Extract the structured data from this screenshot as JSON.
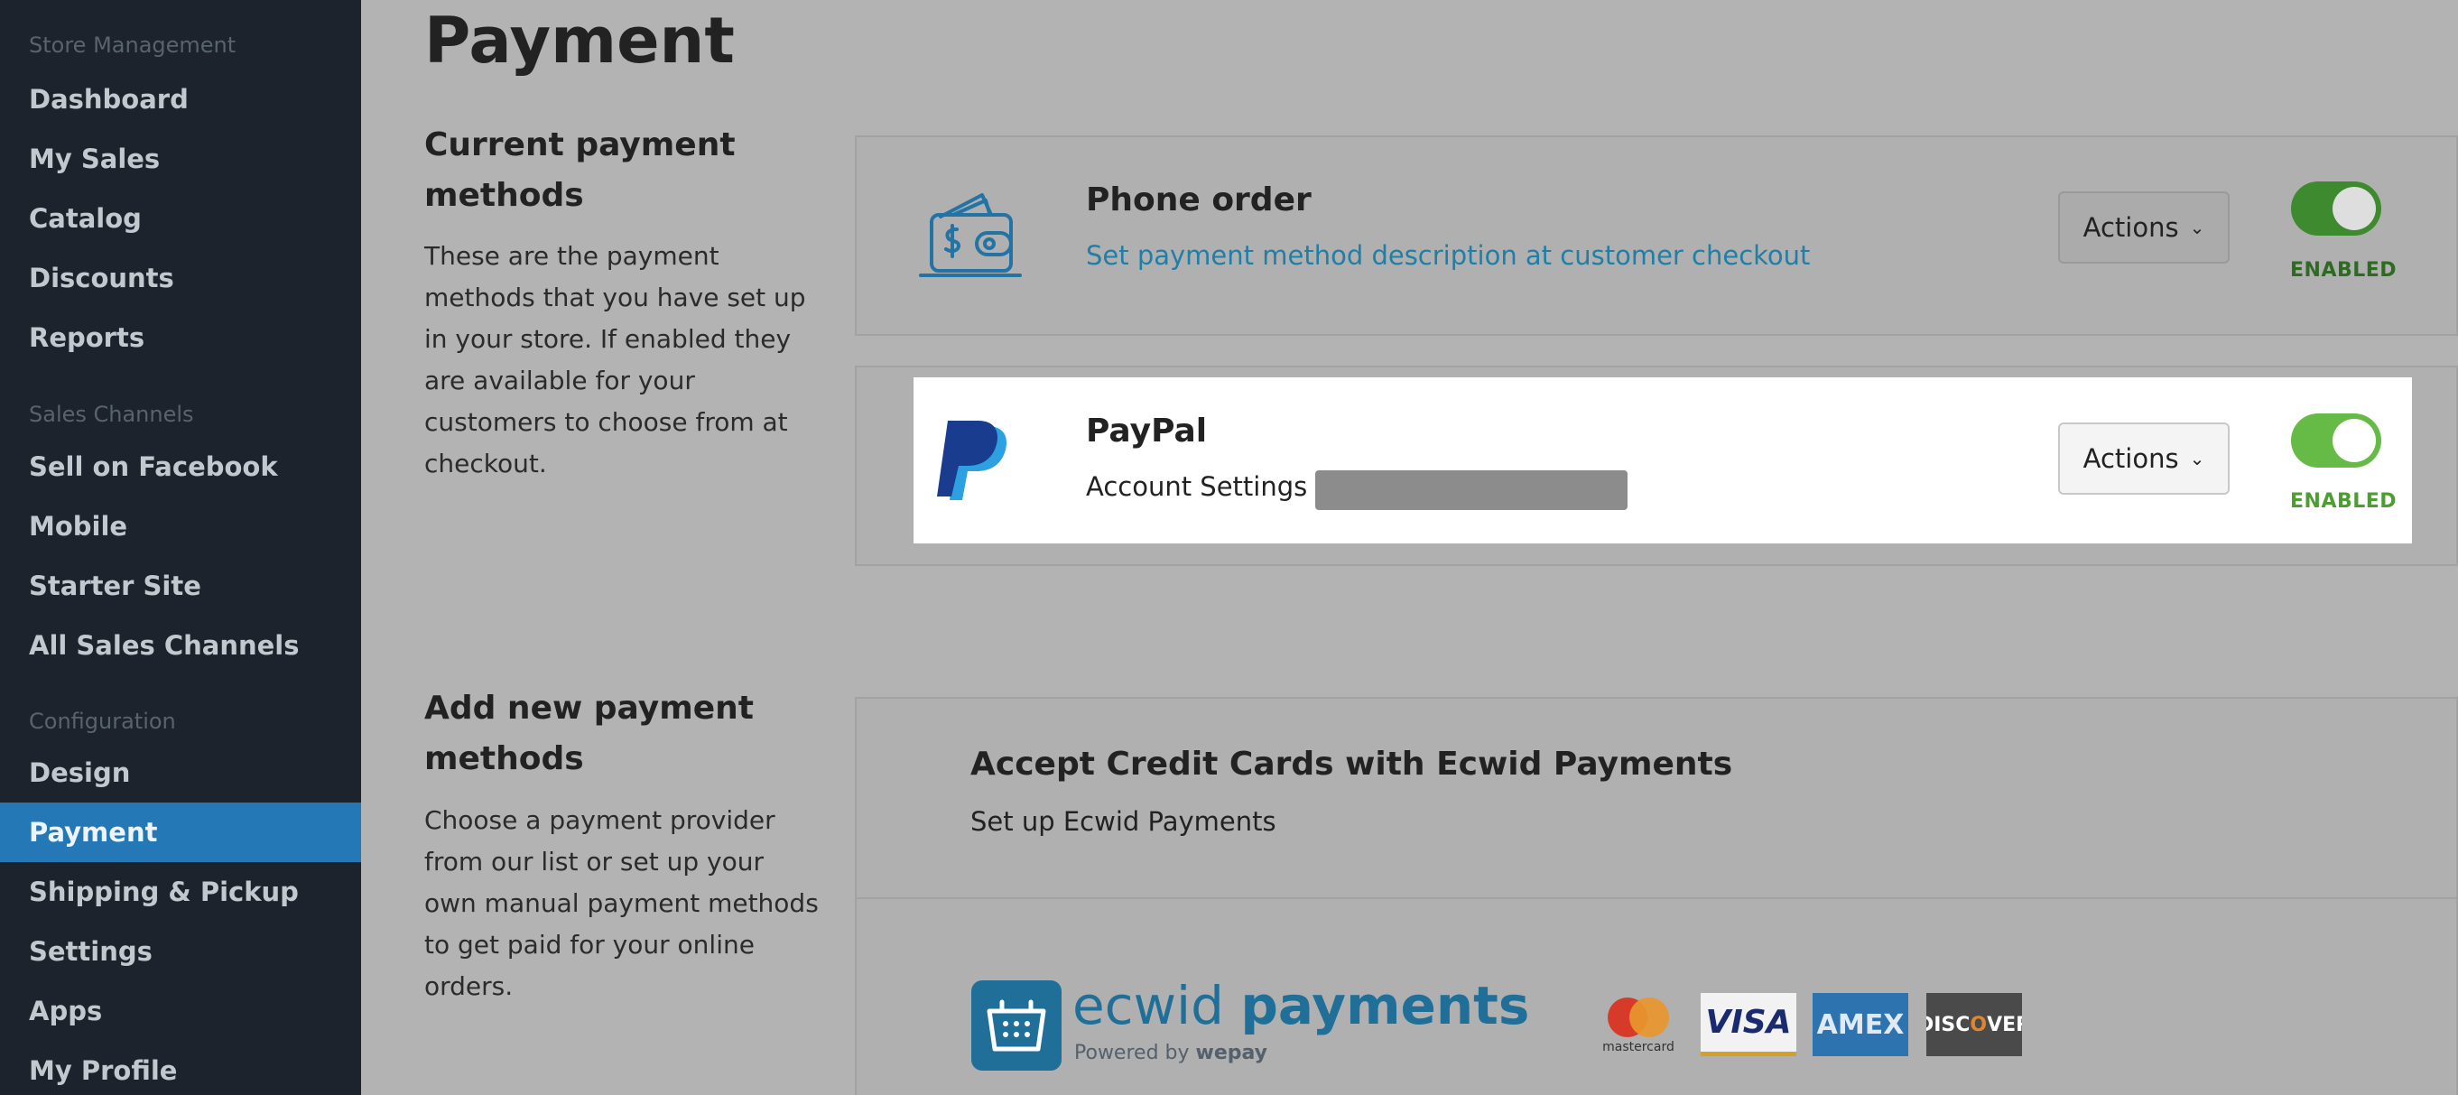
{
  "sidebar": {
    "store_management": {
      "heading": "Store Management",
      "items": [
        {
          "label": "Dashboard"
        },
        {
          "label": "My Sales"
        },
        {
          "label": "Catalog"
        },
        {
          "label": "Discounts"
        },
        {
          "label": "Reports"
        }
      ]
    },
    "sales_channels": {
      "heading": "Sales Channels",
      "items": [
        {
          "label": "Sell on Facebook"
        },
        {
          "label": "Mobile"
        },
        {
          "label": "Starter Site"
        },
        {
          "label": "All Sales Channels"
        }
      ]
    },
    "configuration": {
      "heading": "Configuration",
      "items": [
        {
          "label": "Design"
        },
        {
          "label": "Payment",
          "active": true
        },
        {
          "label": "Shipping & Pickup"
        },
        {
          "label": "Settings"
        },
        {
          "label": "Apps"
        },
        {
          "label": "My Profile"
        }
      ]
    }
  },
  "page": {
    "title": "Payment"
  },
  "current": {
    "heading": "Current payment methods",
    "description": "These are the payment methods that you have set up in your store. If enabled they are available for your customers to choose from at checkout.",
    "methods": [
      {
        "name": "Phone order",
        "link": "Set payment method description at customer checkout",
        "actions_label": "Actions",
        "status": "ENABLED",
        "icon": "wallet-icon"
      },
      {
        "name": "PayPal",
        "account_prefix": "Account Settings —",
        "actions_label": "Actions",
        "status": "ENABLED",
        "icon": "paypal-logo"
      }
    ]
  },
  "add_new": {
    "heading": "Add new payment methods",
    "description": "Choose a payment provider from our list or set up your own manual payment methods to get paid for your online orders.",
    "offer_title": "Accept Credit Cards with Ecwid Payments",
    "offer_subtitle": "Set up Ecwid Payments",
    "brand": {
      "name_light": "ecwid ",
      "name_bold": "payments",
      "powered_prefix": "Powered by ",
      "powered_brand": "wepay"
    },
    "cards": [
      {
        "name": "mastercard",
        "label": "mastercard"
      },
      {
        "name": "visa",
        "label": "VISA"
      },
      {
        "name": "amex",
        "label": "AMEX"
      },
      {
        "name": "discover",
        "label_pre": "DISC",
        "label_o": "O",
        "label_post": "VER"
      }
    ]
  },
  "colors": {
    "sidebar_bg": "#1c232c",
    "active_nav": "#2378b5",
    "link": "#1f7fa6",
    "toggle_on": "#66bb46",
    "brand_blue": "#1f6f99"
  }
}
